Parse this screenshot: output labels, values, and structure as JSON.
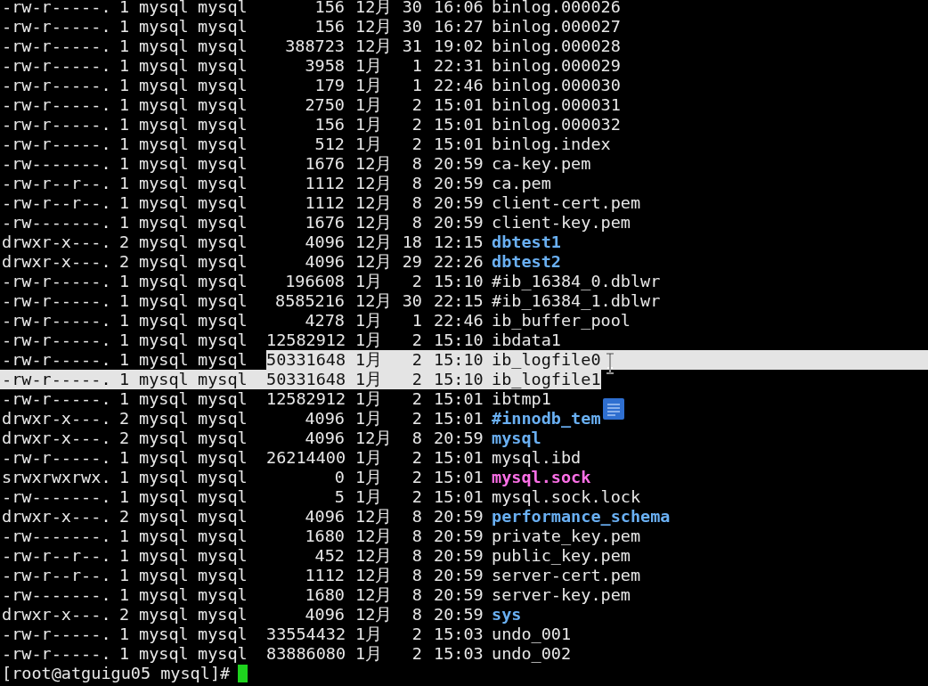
{
  "listing": [
    {
      "perms": "-rw-r-----.",
      "links": "1",
      "owner": "mysql",
      "group": "mysql",
      "size": "156",
      "month": "12月",
      "day": "30",
      "time": "16:06",
      "name": "binlog.000026",
      "kind": "file",
      "selected": false
    },
    {
      "perms": "-rw-r-----.",
      "links": "1",
      "owner": "mysql",
      "group": "mysql",
      "size": "156",
      "month": "12月",
      "day": "30",
      "time": "16:27",
      "name": "binlog.000027",
      "kind": "file",
      "selected": false
    },
    {
      "perms": "-rw-r-----.",
      "links": "1",
      "owner": "mysql",
      "group": "mysql",
      "size": "388723",
      "month": "12月",
      "day": "31",
      "time": "19:02",
      "name": "binlog.000028",
      "kind": "file",
      "selected": false
    },
    {
      "perms": "-rw-r-----.",
      "links": "1",
      "owner": "mysql",
      "group": "mysql",
      "size": "3958",
      "month": "1月",
      "day": "1",
      "time": "22:31",
      "name": "binlog.000029",
      "kind": "file",
      "selected": false
    },
    {
      "perms": "-rw-r-----.",
      "links": "1",
      "owner": "mysql",
      "group": "mysql",
      "size": "179",
      "month": "1月",
      "day": "1",
      "time": "22:46",
      "name": "binlog.000030",
      "kind": "file",
      "selected": false
    },
    {
      "perms": "-rw-r-----.",
      "links": "1",
      "owner": "mysql",
      "group": "mysql",
      "size": "2750",
      "month": "1月",
      "day": "2",
      "time": "15:01",
      "name": "binlog.000031",
      "kind": "file",
      "selected": false
    },
    {
      "perms": "-rw-r-----.",
      "links": "1",
      "owner": "mysql",
      "group": "mysql",
      "size": "156",
      "month": "1月",
      "day": "2",
      "time": "15:01",
      "name": "binlog.000032",
      "kind": "file",
      "selected": false
    },
    {
      "perms": "-rw-r-----.",
      "links": "1",
      "owner": "mysql",
      "group": "mysql",
      "size": "512",
      "month": "1月",
      "day": "2",
      "time": "15:01",
      "name": "binlog.index",
      "kind": "file",
      "selected": false
    },
    {
      "perms": "-rw-------.",
      "links": "1",
      "owner": "mysql",
      "group": "mysql",
      "size": "1676",
      "month": "12月",
      "day": "8",
      "time": "20:59",
      "name": "ca-key.pem",
      "kind": "file",
      "selected": false
    },
    {
      "perms": "-rw-r--r--.",
      "links": "1",
      "owner": "mysql",
      "group": "mysql",
      "size": "1112",
      "month": "12月",
      "day": "8",
      "time": "20:59",
      "name": "ca.pem",
      "kind": "file",
      "selected": false
    },
    {
      "perms": "-rw-r--r--.",
      "links": "1",
      "owner": "mysql",
      "group": "mysql",
      "size": "1112",
      "month": "12月",
      "day": "8",
      "time": "20:59",
      "name": "client-cert.pem",
      "kind": "file",
      "selected": false
    },
    {
      "perms": "-rw-------.",
      "links": "1",
      "owner": "mysql",
      "group": "mysql",
      "size": "1676",
      "month": "12月",
      "day": "8",
      "time": "20:59",
      "name": "client-key.pem",
      "kind": "file",
      "selected": false
    },
    {
      "perms": "drwxr-x---.",
      "links": "2",
      "owner": "mysql",
      "group": "mysql",
      "size": "4096",
      "month": "12月",
      "day": "18",
      "time": "12:15",
      "name": "dbtest1",
      "kind": "dir",
      "selected": false
    },
    {
      "perms": "drwxr-x---.",
      "links": "2",
      "owner": "mysql",
      "group": "mysql",
      "size": "4096",
      "month": "12月",
      "day": "29",
      "time": "22:26",
      "name": "dbtest2",
      "kind": "dir",
      "selected": false
    },
    {
      "perms": "-rw-r-----.",
      "links": "1",
      "owner": "mysql",
      "group": "mysql",
      "size": "196608",
      "month": "1月",
      "day": "2",
      "time": "15:10",
      "name": "#ib_16384_0.dblwr",
      "kind": "file",
      "selected": false
    },
    {
      "perms": "-rw-r-----.",
      "links": "1",
      "owner": "mysql",
      "group": "mysql",
      "size": "8585216",
      "month": "12月",
      "day": "30",
      "time": "22:15",
      "name": "#ib_16384_1.dblwr",
      "kind": "file",
      "selected": false
    },
    {
      "perms": "-rw-r-----.",
      "links": "1",
      "owner": "mysql",
      "group": "mysql",
      "size": "4278",
      "month": "1月",
      "day": "1",
      "time": "22:46",
      "name": "ib_buffer_pool",
      "kind": "file",
      "selected": false
    },
    {
      "perms": "-rw-r-----.",
      "links": "1",
      "owner": "mysql",
      "group": "mysql",
      "size": "12582912",
      "month": "1月",
      "day": "2",
      "time": "15:10",
      "name": "ibdata1",
      "kind": "file",
      "selected": false
    },
    {
      "perms": "-rw-r-----.",
      "links": "1",
      "owner": "mysql",
      "group": "mysql",
      "size": "50331648",
      "month": "1月",
      "day": "2",
      "time": "15:10",
      "name": "ib_logfile0",
      "kind": "file",
      "selected": true
    },
    {
      "perms": "-rw-r-----.",
      "links": "1",
      "owner": "mysql",
      "group": "mysql",
      "size": "50331648",
      "month": "1月",
      "day": "2",
      "time": "15:10",
      "name": "ib_logfile1",
      "kind": "file",
      "selected": true
    },
    {
      "perms": "-rw-r-----.",
      "links": "1",
      "owner": "mysql",
      "group": "mysql",
      "size": "12582912",
      "month": "1月",
      "day": "2",
      "time": "15:01",
      "name": "ibtmp1",
      "kind": "file",
      "selected": false
    },
    {
      "perms": "drwxr-x---.",
      "links": "2",
      "owner": "mysql",
      "group": "mysql",
      "size": "4096",
      "month": "1月",
      "day": "2",
      "time": "15:01",
      "name": "#innodb_tem",
      "kind": "dir",
      "selected": false
    },
    {
      "perms": "drwxr-x---.",
      "links": "2",
      "owner": "mysql",
      "group": "mysql",
      "size": "4096",
      "month": "12月",
      "day": "8",
      "time": "20:59",
      "name": "mysql",
      "kind": "dir",
      "selected": false
    },
    {
      "perms": "-rw-r-----.",
      "links": "1",
      "owner": "mysql",
      "group": "mysql",
      "size": "26214400",
      "month": "1月",
      "day": "2",
      "time": "15:01",
      "name": "mysql.ibd",
      "kind": "file",
      "selected": false
    },
    {
      "perms": "srwxrwxrwx.",
      "links": "1",
      "owner": "mysql",
      "group": "mysql",
      "size": "0",
      "month": "1月",
      "day": "2",
      "time": "15:01",
      "name": "mysql.sock",
      "kind": "socket",
      "selected": false
    },
    {
      "perms": "-rw-------.",
      "links": "1",
      "owner": "mysql",
      "group": "mysql",
      "size": "5",
      "month": "1月",
      "day": "2",
      "time": "15:01",
      "name": "mysql.sock.lock",
      "kind": "file",
      "selected": false
    },
    {
      "perms": "drwxr-x---.",
      "links": "2",
      "owner": "mysql",
      "group": "mysql",
      "size": "4096",
      "month": "12月",
      "day": "8",
      "time": "20:59",
      "name": "performance_schema",
      "kind": "dir",
      "selected": false
    },
    {
      "perms": "-rw-------.",
      "links": "1",
      "owner": "mysql",
      "group": "mysql",
      "size": "1680",
      "month": "12月",
      "day": "8",
      "time": "20:59",
      "name": "private_key.pem",
      "kind": "file",
      "selected": false
    },
    {
      "perms": "-rw-r--r--.",
      "links": "1",
      "owner": "mysql",
      "group": "mysql",
      "size": "452",
      "month": "12月",
      "day": "8",
      "time": "20:59",
      "name": "public_key.pem",
      "kind": "file",
      "selected": false
    },
    {
      "perms": "-rw-r--r--.",
      "links": "1",
      "owner": "mysql",
      "group": "mysql",
      "size": "1112",
      "month": "12月",
      "day": "8",
      "time": "20:59",
      "name": "server-cert.pem",
      "kind": "file",
      "selected": false
    },
    {
      "perms": "-rw-------.",
      "links": "1",
      "owner": "mysql",
      "group": "mysql",
      "size": "1680",
      "month": "12月",
      "day": "8",
      "time": "20:59",
      "name": "server-key.pem",
      "kind": "file",
      "selected": false
    },
    {
      "perms": "drwxr-x---.",
      "links": "2",
      "owner": "mysql",
      "group": "mysql",
      "size": "4096",
      "month": "12月",
      "day": "8",
      "time": "20:59",
      "name": "sys",
      "kind": "dir",
      "selected": false
    },
    {
      "perms": "-rw-r-----.",
      "links": "1",
      "owner": "mysql",
      "group": "mysql",
      "size": "33554432",
      "month": "1月",
      "day": "2",
      "time": "15:03",
      "name": "undo_001",
      "kind": "file",
      "selected": false
    },
    {
      "perms": "-rw-r-----.",
      "links": "1",
      "owner": "mysql",
      "group": "mysql",
      "size": "83886080",
      "month": "1月",
      "day": "2",
      "time": "15:03",
      "name": "undo_002",
      "kind": "file",
      "selected": false
    }
  ],
  "prompt": "[root@atguigu05 mysql]#"
}
